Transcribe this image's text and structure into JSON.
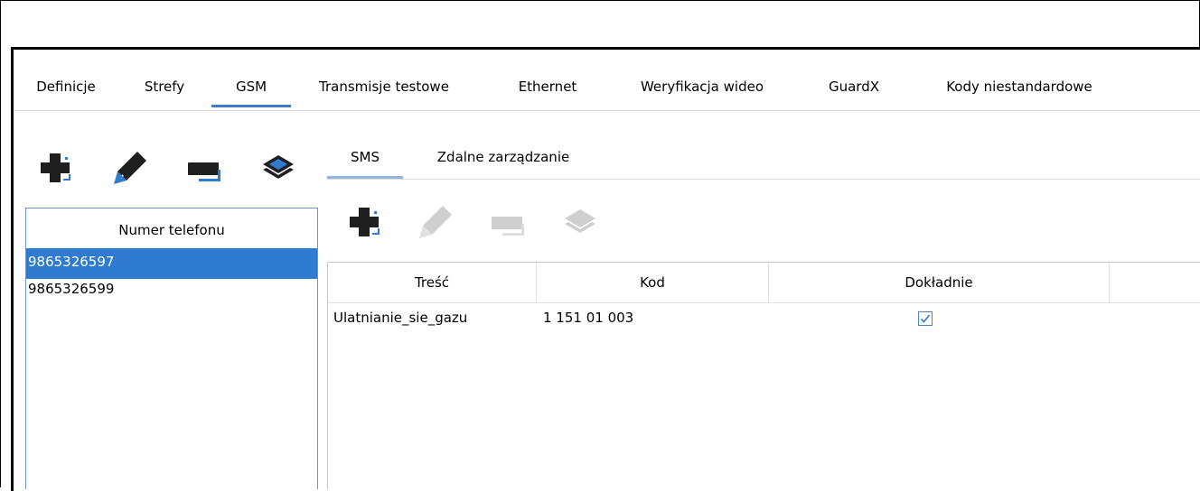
{
  "main_tabs": [
    {
      "label": "Definicje",
      "active": false
    },
    {
      "label": "Strefy",
      "active": false
    },
    {
      "label": "GSM",
      "active": true
    },
    {
      "label": "Transmisje testowe",
      "active": false
    },
    {
      "label": "Ethernet",
      "active": false
    },
    {
      "label": "Weryfikacja wideo",
      "active": false
    },
    {
      "label": "GuardX",
      "active": false
    },
    {
      "label": "Kody niestandardowe",
      "active": false
    }
  ],
  "left_toolbar": {
    "icons": [
      "add-icon",
      "edit-icon",
      "delete-icon",
      "layers-icon"
    ]
  },
  "phone_list": {
    "header": "Numer telefonu",
    "items": [
      "9865326597",
      "9865326599"
    ],
    "selected_index": 0
  },
  "sub_tabs": [
    {
      "label": "SMS",
      "active": true
    },
    {
      "label": "Zdalne zarządzanie",
      "active": false
    }
  ],
  "sms_toolbar": {
    "icons": [
      "add-icon",
      "edit-icon",
      "delete-icon",
      "layers-icon"
    ],
    "enabled": [
      true,
      false,
      false,
      false
    ]
  },
  "sms_table": {
    "columns": [
      "Treść",
      "Kod",
      "Dokładnie"
    ],
    "rows": [
      {
        "tresc": "Ulatnianie_sie_gazu",
        "kod": "1 151 01 003",
        "dokladnie": true
      }
    ]
  },
  "colors": {
    "accent": "#3b7dc4",
    "selection": "#2f7bd0",
    "icon_dark": "#1f1f1f",
    "icon_disabled": "#c8c8c8"
  }
}
